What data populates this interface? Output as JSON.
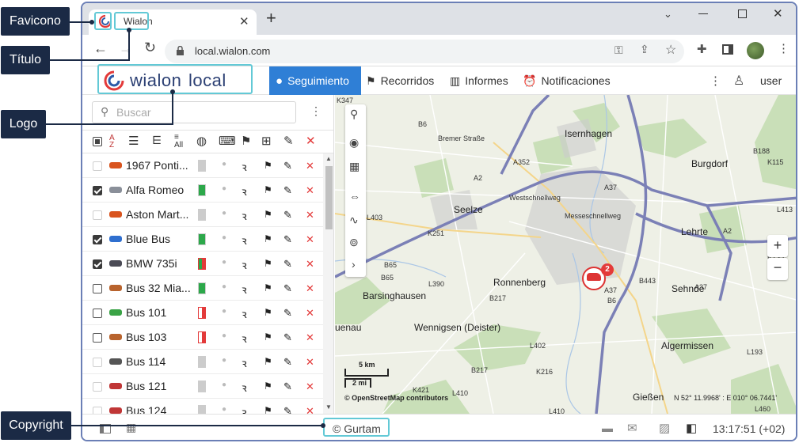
{
  "callouts": {
    "favicon": "Favicono",
    "title": "Título",
    "logo": "Logo",
    "copyright": "Copyright"
  },
  "browser": {
    "tab_title": "Wialon",
    "url": "local.wialon.com"
  },
  "app": {
    "logo_text_a": "wialon",
    "logo_text_b": "local",
    "nav": [
      {
        "label": "Seguimiento"
      },
      {
        "label": "Recorridos"
      },
      {
        "label": "Informes"
      },
      {
        "label": "Notificaciones"
      }
    ],
    "user": "user"
  },
  "search": {
    "placeholder": "Buscar"
  },
  "units": [
    {
      "name": "1967 Ponti...",
      "checked": false,
      "status": "grey",
      "color": "#d9541e"
    },
    {
      "name": "Alfa Romeo",
      "checked": true,
      "status": "green",
      "color": "#8a8f99"
    },
    {
      "name": "Aston Mart...",
      "checked": false,
      "status": "grey",
      "color": "#d9541e"
    },
    {
      "name": "Blue Bus",
      "checked": true,
      "status": "green",
      "color": "#2f6fcf"
    },
    {
      "name": "BMW 735i",
      "checked": true,
      "status": "half",
      "color": "#4a4a55"
    },
    {
      "name": "Bus 32 Mia...",
      "checked": false,
      "status": "green",
      "color": "#b8632d"
    },
    {
      "name": "Bus 101",
      "checked": false,
      "status": "red",
      "color": "#3aa346"
    },
    {
      "name": "Bus 103",
      "checked": false,
      "status": "red",
      "color": "#b8632d"
    },
    {
      "name": "Bus 114",
      "checked": false,
      "status": "grey",
      "color": "#555"
    },
    {
      "name": "Bus 121",
      "checked": false,
      "status": "grey",
      "color": "#c03636"
    },
    {
      "name": "Bus 124",
      "checked": false,
      "status": "grey",
      "color": "#c03636"
    }
  ],
  "map": {
    "places": [
      "Isernhagen",
      "Burgdorf",
      "Seelze",
      "Lehrte",
      "Ronnenberg",
      "Barsinghausen",
      "Sehnde",
      "Wennigsen (Deister)",
      "Algermissen",
      "Gießen"
    ],
    "roads": [
      "K347",
      "B6",
      "Bremer Straße",
      "A352",
      "A2",
      "B188",
      "K115",
      "A37",
      "L403",
      "Westschnellweg",
      "Messeschnellweg",
      "K251",
      "A37",
      "A2",
      "L413",
      "B65",
      "B65",
      "B443",
      "K135",
      "A37",
      "B6",
      "L390",
      "B217",
      "L402",
      "B217",
      "K216",
      "L410",
      "K421",
      "L193",
      "L410",
      "L460"
    ],
    "marker_badge": "2",
    "scale_km": "5 km",
    "scale_mi": "2 mi",
    "attribution": "© OpenStreetMap contributors",
    "coords": "N 52° 11.9968' : E 010° 06.7441'",
    "partial_label": "uenau"
  },
  "status": {
    "copyright": "© Gurtam",
    "clock": "13:17:51 (+02)"
  },
  "colors": {
    "accent": "#2f7fd6",
    "callout": "#1b2a45",
    "highlight": "#63c9d6",
    "map_road": "#7b80b6",
    "water": "#aac6e6",
    "forest": "#c9dfb8"
  }
}
